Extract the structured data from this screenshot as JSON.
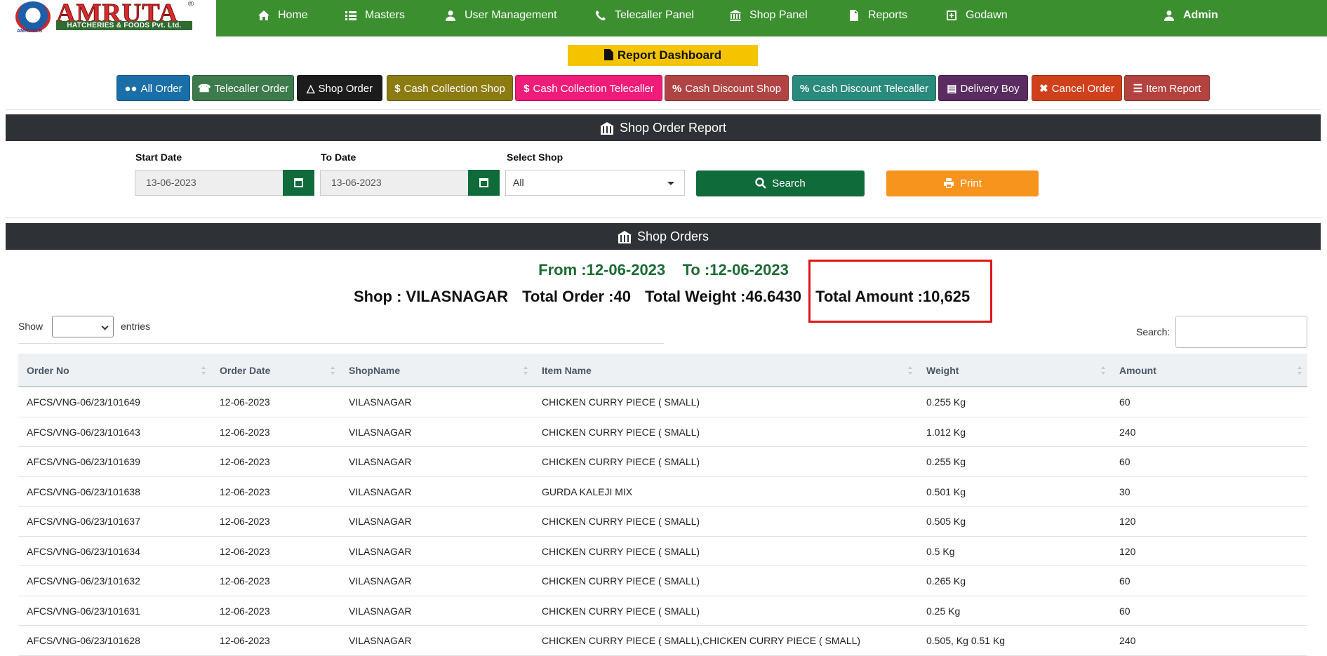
{
  "brand": {
    "name": "AMRUTA",
    "reg_mark": "®",
    "subtitle": "HATCHERIES & FOODS Pvt. Ltd.",
    "logo_label": "AMRUTA'S"
  },
  "nav": {
    "home": "Home",
    "masters": "Masters",
    "user_management": "User Management",
    "telecaller_panel": "Telecaller Panel",
    "shop_panel": "Shop Panel",
    "reports": "Reports",
    "godawn": "Godawn",
    "admin": "Admin"
  },
  "dashboard": {
    "title": "Report Dashboard",
    "buttons": [
      {
        "label": "All Order",
        "color": "#1b6fa8"
      },
      {
        "label": "Telecaller Order",
        "color": "#3d7a4c"
      },
      {
        "label": "Shop Order",
        "color": "#1c1c1c"
      },
      {
        "label": "Cash Collection Shop",
        "color": "#8c7b10"
      },
      {
        "label": "Cash Collection Telecaller",
        "color": "#f01c7a"
      },
      {
        "label": "Cash Discount Shop",
        "color": "#b04444"
      },
      {
        "label": "Cash Discount Telecaller",
        "color": "#2a8a7c"
      },
      {
        "label": "Delivery Boy",
        "color": "#5b2c62"
      },
      {
        "label": "Cancel Order",
        "color": "#d1401c"
      },
      {
        "label": "Item Report",
        "color": "#b4423f"
      }
    ]
  },
  "report": {
    "header": "Shop Order Report",
    "start_label": "Start Date",
    "start_value": "13-06-2023",
    "to_label": "To Date",
    "to_value": "13-06-2023",
    "shop_label": "Select Shop",
    "shop_value": "All",
    "search_btn": "Search",
    "print_btn": "Print"
  },
  "orders": {
    "header": "Shop Orders",
    "period_from": "From :12-06-2023",
    "period_to": "To :12-06-2023",
    "shop": "Shop : VILASNAGAR",
    "total_order": "Total Order :40",
    "total_weight": "Total Weight :46.6430",
    "total_amount": "Total Amount :10,625",
    "show_label": "Show",
    "entries_label": "entries",
    "search_label": "Search:",
    "columns": [
      "Order No",
      "Order Date",
      "ShopName",
      "Item Name",
      "Weight",
      "Amount"
    ],
    "rows": [
      [
        "AFCS/VNG-06/23/101649",
        "12-06-2023",
        "VILASNAGAR",
        "CHICKEN CURRY PIECE ( SMALL)",
        "0.255 Kg",
        "60"
      ],
      [
        "AFCS/VNG-06/23/101643",
        "12-06-2023",
        "VILASNAGAR",
        "CHICKEN CURRY PIECE ( SMALL)",
        "1.012 Kg",
        "240"
      ],
      [
        "AFCS/VNG-06/23/101639",
        "12-06-2023",
        "VILASNAGAR",
        "CHICKEN CURRY PIECE ( SMALL)",
        "0.255 Kg",
        "60"
      ],
      [
        "AFCS/VNG-06/23/101638",
        "12-06-2023",
        "VILASNAGAR",
        "GURDA KALEJI MIX",
        "0.501 Kg",
        "30"
      ],
      [
        "AFCS/VNG-06/23/101637",
        "12-06-2023",
        "VILASNAGAR",
        "CHICKEN CURRY PIECE ( SMALL)",
        "0.505 Kg",
        "120"
      ],
      [
        "AFCS/VNG-06/23/101634",
        "12-06-2023",
        "VILASNAGAR",
        "CHICKEN CURRY PIECE ( SMALL)",
        "0.5 Kg",
        "120"
      ],
      [
        "AFCS/VNG-06/23/101632",
        "12-06-2023",
        "VILASNAGAR",
        "CHICKEN CURRY PIECE ( SMALL)",
        "0.265 Kg",
        "60"
      ],
      [
        "AFCS/VNG-06/23/101631",
        "12-06-2023",
        "VILASNAGAR",
        "CHICKEN CURRY PIECE ( SMALL)",
        "0.25 Kg",
        "60"
      ],
      [
        "AFCS/VNG-06/23/101628",
        "12-06-2023",
        "VILASNAGAR",
        "CHICKEN CURRY PIECE ( SMALL),CHICKEN CURRY PIECE ( SMALL)",
        "0.505, Kg 0.51 Kg",
        "240"
      ]
    ]
  },
  "colors": {
    "nav_green": "#3b8f2f",
    "dark_header": "#2e3135",
    "highlight_red": "#e01616",
    "period_green": "#1b6b33"
  }
}
